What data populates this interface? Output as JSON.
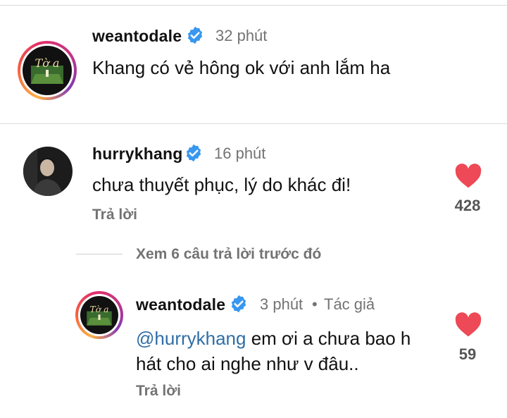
{
  "comments": [
    {
      "username": "weantodale",
      "verified": true,
      "time": "32 phút",
      "text": "Khang có vẻ hông ok với anh lắm ha",
      "avatar_icon": "album-art-avatar"
    },
    {
      "username": "hurrykhang",
      "verified": true,
      "time": "16 phút",
      "text": "chưa thuyết phục, lý do khác đi!",
      "reply_label": "Trả lời",
      "like_count": "428",
      "avatar_icon": "profile-photo-avatar"
    }
  ],
  "view_replies": "Xem 6 câu trả lời trước đó",
  "reply": {
    "username": "weantodale",
    "verified": true,
    "time": "3 phút",
    "separator": "•",
    "author_tag": "Tác giả",
    "mention": "@hurrykhang",
    "text_line1": " em ơi a chưa bao h",
    "text_line2": "hát cho ai nghe như v đâu..",
    "reply_label": "Trả lời",
    "like_count": "59",
    "avatar_icon": "album-art-avatar"
  },
  "colors": {
    "heart": "#ed4956",
    "verified": "#3897f0",
    "mention": "#2f6ea5",
    "muted": "#737373"
  }
}
